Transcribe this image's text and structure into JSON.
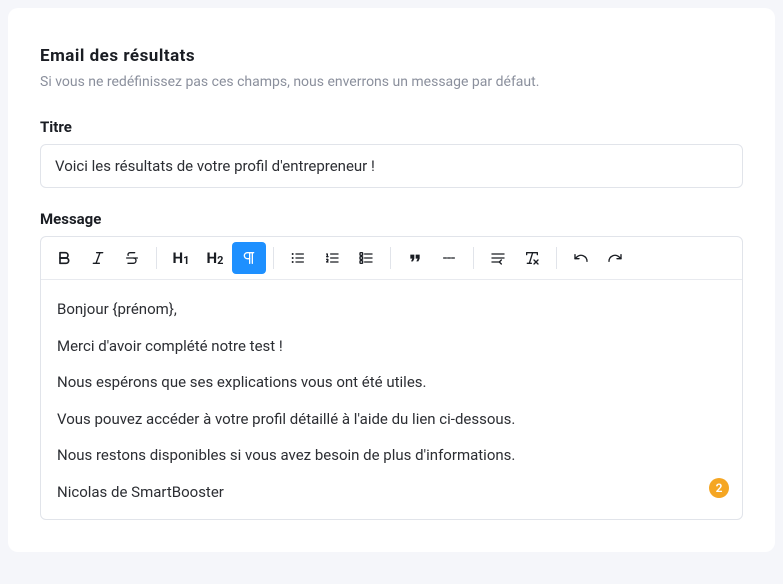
{
  "section": {
    "title": "Email des résultats",
    "subtitle": "Si vous ne redéfinissez pas ces champs, nous enverrons un message par défaut."
  },
  "fields": {
    "titre_label": "Titre",
    "titre_value": "Voici les résultats de votre profil d'entrepreneur !",
    "message_label": "Message"
  },
  "toolbar": {
    "h1": "H",
    "h1_sub": "1",
    "h2": "H",
    "h2_sub": "2"
  },
  "message_body": {
    "p1": "Bonjour {prénom},",
    "p2": "Merci d'avoir complété notre test !",
    "p3": "Nous espérons que ses explications vous ont été utiles.",
    "p4": "Vous pouvez accéder à votre profil détaillé à l'aide du lien ci-dessous.",
    "p5": "Nous restons disponibles si vous avez besoin de plus d'informations.",
    "p6": "Nicolas de SmartBooster"
  },
  "badge": {
    "count": "2"
  }
}
